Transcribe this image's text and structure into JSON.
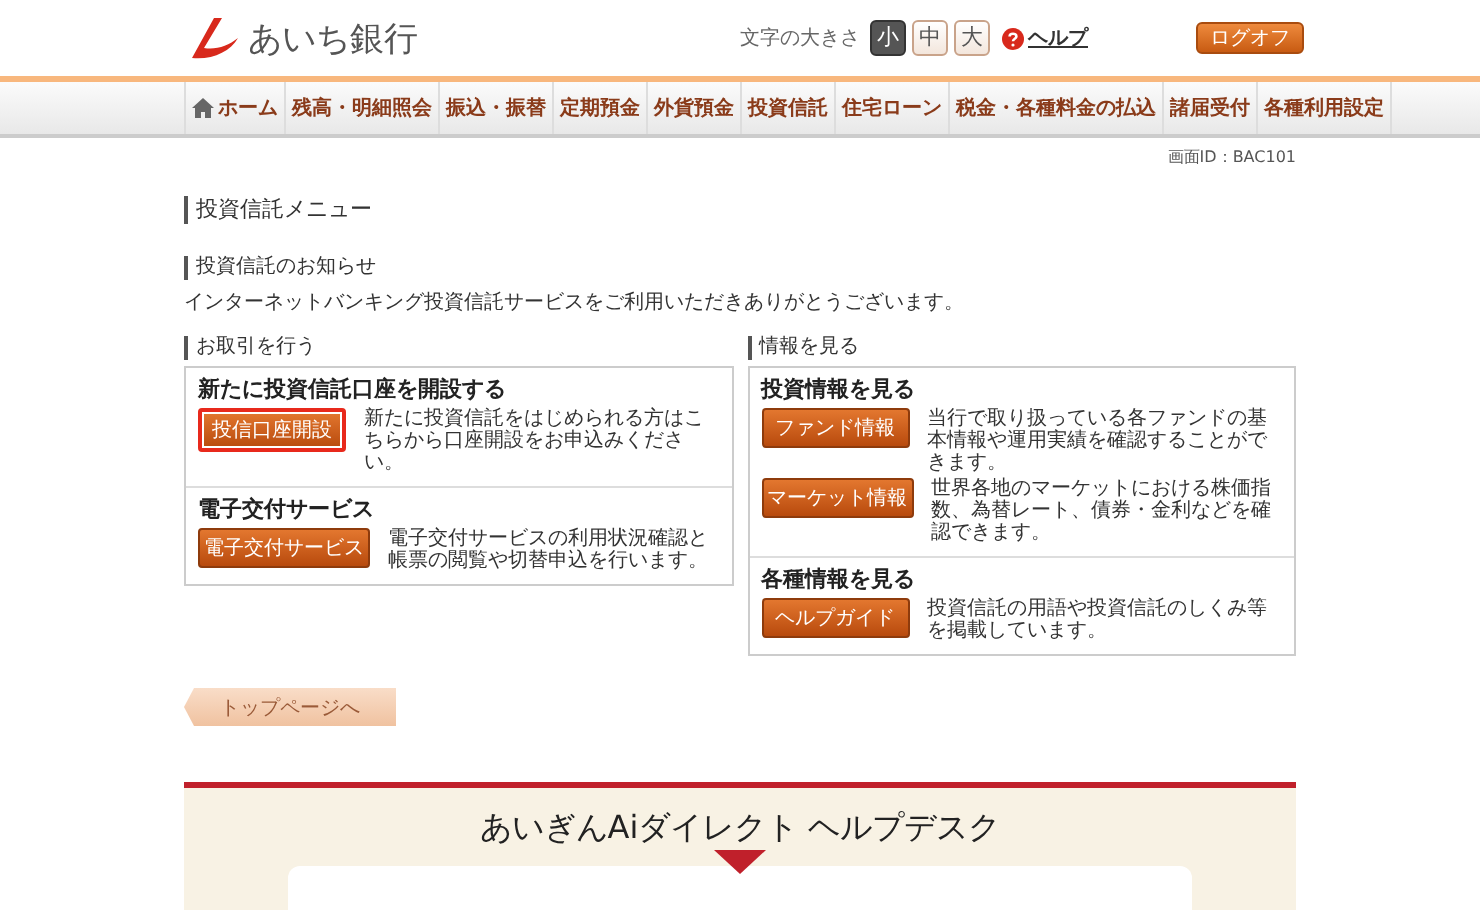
{
  "header": {
    "bank_name": "あいち銀行",
    "font_size_label": "文字の大きさ",
    "font_sizes": [
      {
        "label": "小",
        "selected": true
      },
      {
        "label": "中",
        "selected": false
      },
      {
        "label": "大",
        "selected": false
      }
    ],
    "help_link": "ヘルプ",
    "logout_button": "ログオフ"
  },
  "nav": [
    {
      "label": "ホーム",
      "kind": "home"
    },
    {
      "label": "残高・明細照会",
      "kind": "plain"
    },
    {
      "label": "振込・振替",
      "kind": "plain"
    },
    {
      "label": "定期預金",
      "kind": "plain"
    },
    {
      "label": "外貨預金",
      "kind": "plain"
    },
    {
      "label": "投資信託",
      "kind": "plain"
    },
    {
      "label": "住宅ローン",
      "kind": "plain"
    },
    {
      "label": "税金・各種料金の払込",
      "kind": "plain"
    },
    {
      "label": "諸届受付",
      "kind": "plain"
    },
    {
      "label": "各種利用設定",
      "kind": "plain"
    }
  ],
  "screen_id": "画面ID：BAC101",
  "page_title": "投資信託メニュー",
  "notice": {
    "heading": "投資信託のお知らせ",
    "text": "インターネットバンキング投資信託サービスをご利用いただきありがとうございます。"
  },
  "panels": [
    {
      "heading": "お取引を行う",
      "sections": [
        {
          "title": "新たに投資信託口座を開設する",
          "items": [
            {
              "button": "投信口座開設",
              "highlighted": true,
              "description": "新たに投資信託をはじめられる方はこちらから口座開設をお申込みください。"
            }
          ]
        },
        {
          "title": "電子交付サービス",
          "items": [
            {
              "button": "電子交付サービス",
              "highlighted": false,
              "description": "電子交付サービスの利用状況確認と帳票の閲覧や切替申込を行います。"
            }
          ]
        }
      ]
    },
    {
      "heading": "情報を見る",
      "sections": [
        {
          "title": "投資情報を見る",
          "items": [
            {
              "button": "ファンド情報",
              "highlighted": false,
              "description": "当行で取り扱っている各ファンドの基本情報や運用実績を確認することができます。"
            },
            {
              "button": "マーケット情報",
              "highlighted": false,
              "description": "世界各地のマーケットにおける株価指数、為替レート、債券・金利などを確認できます。"
            }
          ]
        },
        {
          "title": "各種情報を見る",
          "items": [
            {
              "button": "ヘルプガイド",
              "highlighted": false,
              "description": "投資信託の用語や投資信託のしくみ等を掲載しています。"
            }
          ]
        }
      ]
    }
  ],
  "back_button": "トップページへ",
  "helpdesk": {
    "title": "あいぎんAiダイレクト ヘルプデスク"
  }
}
